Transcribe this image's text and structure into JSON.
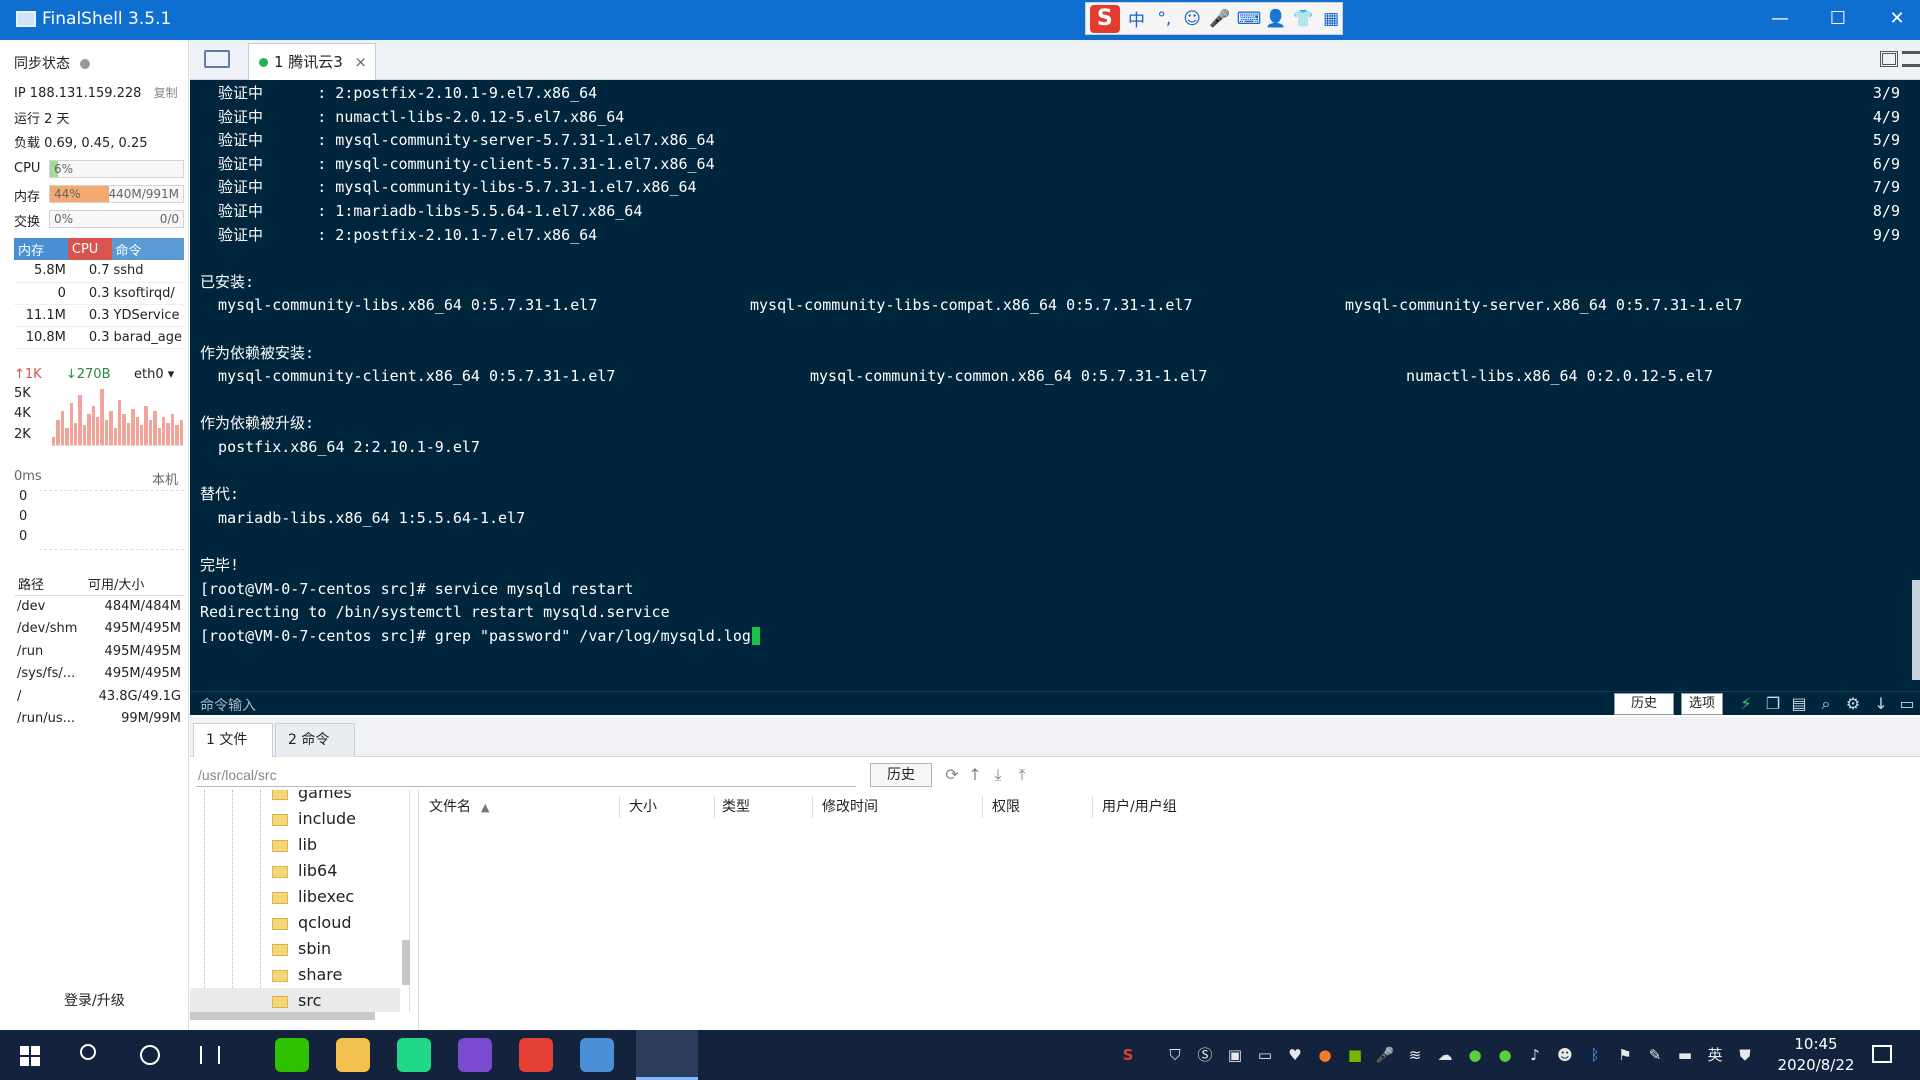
{
  "window": {
    "title": "FinalShell 3.5.1",
    "ime_logo": "S",
    "ime_glyphs": [
      "中",
      "°,",
      "☺",
      "🎤",
      "⌨",
      "👤",
      "👕",
      "▦"
    ],
    "min": "—",
    "max": "☐",
    "close": "✕"
  },
  "sidebar": {
    "sync_label": "同步状态",
    "ip": "IP 188.131.159.228",
    "copy": "复制",
    "uptime": "运行 2 天",
    "load": "负载 0.69, 0.45, 0.25",
    "cpu": {
      "label": "CPU",
      "pct": "6%",
      "value": 6
    },
    "mem": {
      "label": "内存",
      "pct": "44%",
      "detail": "440M/991M",
      "value": 44
    },
    "swap": {
      "label": "交换",
      "pct": "0%",
      "detail": "0/0",
      "value": 0
    },
    "proc_headers": [
      "内存",
      "CPU",
      "命令"
    ],
    "processes": [
      {
        "mem": "5.8M",
        "cpu": "0.7",
        "cmd": "sshd"
      },
      {
        "mem": "0",
        "cpu": "0.3",
        "cmd": "ksoftirqd/"
      },
      {
        "mem": "11.1M",
        "cpu": "0.3",
        "cmd": "YDService"
      },
      {
        "mem": "10.8M",
        "cpu": "0.3",
        "cmd": "barad_age"
      }
    ],
    "net_up": "1K",
    "net_down": "270B",
    "net_iface": "eth0",
    "net_ticks": [
      "5K",
      "4K",
      "2K"
    ],
    "net_bars": [
      0.15,
      0.45,
      0.6,
      0.3,
      0.75,
      0.4,
      0.9,
      0.35,
      0.55,
      0.7,
      0.5,
      1.0,
      0.45,
      0.6,
      0.3,
      0.8,
      0.55,
      0.4,
      0.65,
      0.5,
      0.35,
      0.7,
      0.45,
      0.6,
      0.3,
      0.5,
      0.4,
      0.55,
      0.35,
      0.45
    ],
    "ping_label": "0ms",
    "ping_host": "本机",
    "ping_vals": [
      "0",
      "0",
      "0"
    ],
    "disk_headers": [
      "路径",
      "可用/大小"
    ],
    "disks": [
      {
        "path": "/dev",
        "size": "484M/484M"
      },
      {
        "path": "/dev/shm",
        "size": "495M/495M"
      },
      {
        "path": "/run",
        "size": "495M/495M"
      },
      {
        "path": "/sys/fs/...",
        "size": "495M/495M"
      },
      {
        "path": "/",
        "size": "43.8G/49.1G"
      },
      {
        "path": "/run/us...",
        "size": "99M/99M"
      }
    ],
    "login": "登录/升级"
  },
  "tabs": {
    "session": "1 腾讯云3",
    "close": "×"
  },
  "terminal": {
    "lines": [
      {
        "t": "  验证中      : 2:postfix-2.10.1-9.el7.x86_64",
        "r": "3/9"
      },
      {
        "t": "  验证中      : numactl-libs-2.0.12-5.el7.x86_64",
        "r": "4/9"
      },
      {
        "t": "  验证中      : mysql-community-server-5.7.31-1.el7.x86_64",
        "r": "5/9"
      },
      {
        "t": "  验证中      : mysql-community-client-5.7.31-1.el7.x86_64",
        "r": "6/9"
      },
      {
        "t": "  验证中      : mysql-community-libs-5.7.31-1.el7.x86_64",
        "r": "7/9"
      },
      {
        "t": "  验证中      : 1:mariadb-libs-5.5.64-1.el7.x86_64",
        "r": "8/9"
      },
      {
        "t": "  验证中      : 2:postfix-2.10.1-7.el7.x86_64",
        "r": "9/9"
      },
      {
        "t": "",
        "r": ""
      },
      {
        "t": "已安装:",
        "r": ""
      },
      {
        "t": "  mysql-community-libs.x86_64 0:5.7.31-1.el7",
        "c2": "mysql-community-libs-compat.x86_64 0:5.7.31-1.el7",
        "c3": "mysql-community-server.x86_64 0:5.7.31-1.el7"
      },
      {
        "t": "",
        "r": ""
      },
      {
        "t": "作为依赖被安装:",
        "r": ""
      },
      {
        "t": "  mysql-community-client.x86_64 0:5.7.31-1.el7",
        "c2": "mysql-community-common.x86_64 0:5.7.31-1.el7",
        "c3": "numactl-libs.x86_64 0:2.0.12-5.el7"
      },
      {
        "t": "",
        "r": ""
      },
      {
        "t": "作为依赖被升级:",
        "r": ""
      },
      {
        "t": "  postfix.x86_64 2:2.10.1-9.el7",
        "r": ""
      },
      {
        "t": "",
        "r": ""
      },
      {
        "t": "替代:",
        "r": ""
      },
      {
        "t": "  mariadb-libs.x86_64 1:5.5.64-1.el7",
        "r": ""
      },
      {
        "t": "",
        "r": ""
      },
      {
        "t": "完毕!",
        "r": ""
      },
      {
        "t": "[root@VM-0-7-centos src]# service mysqld restart",
        "r": ""
      },
      {
        "t": "Redirecting to /bin/systemctl restart mysqld.service",
        "r": ""
      },
      {
        "t": "[root@VM-0-7-centos src]# grep \"password\" /var/log/mysqld.log",
        "r": "",
        "cursor": true
      }
    ],
    "cmd_input_label": "命令输入",
    "history_btn": "历史",
    "options_btn": "选项"
  },
  "files": {
    "tab1": "1 文件",
    "tab2": "2 命令",
    "path": "/usr/local/src",
    "history_btn": "历史",
    "tree": [
      "games",
      "include",
      "lib",
      "lib64",
      "libexec",
      "qcloud",
      "sbin",
      "share",
      "src"
    ],
    "columns": [
      "文件名",
      "大小",
      "类型",
      "修改时间",
      "权限",
      "用户/用户组"
    ]
  },
  "taskbar": {
    "time": "10:45",
    "date": "2020/8/22",
    "apps": [
      {
        "name": "wechat",
        "color": "#2dc100"
      },
      {
        "name": "explorer",
        "color": "#f2c14e"
      },
      {
        "name": "pycharm",
        "color": "#21d789"
      },
      {
        "name": "app-purple",
        "color": "#7a4bd0"
      },
      {
        "name": "chrome",
        "color": "#e44134"
      },
      {
        "name": "app-blue",
        "color": "#4a90d9"
      },
      {
        "name": "finalshell",
        "color": "#2f7fd8"
      }
    ]
  },
  "colors": {
    "titlebar": "#0e6fd0",
    "terminal_bg": "#00263d",
    "proc_mem": "#4a8fd6",
    "proc_cpu": "#d9534f",
    "proc_cmd": "#5b9bd5",
    "mem_fill": "#f4a872",
    "cpu_fill": "#a8d8a0"
  }
}
